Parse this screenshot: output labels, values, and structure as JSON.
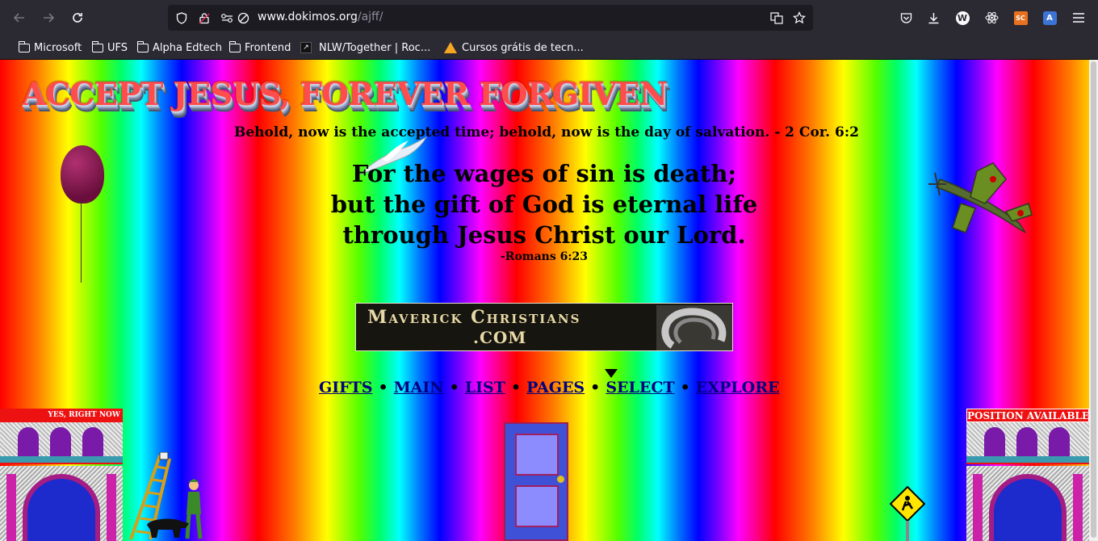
{
  "browser": {
    "url_host": "www.dokimos.org",
    "url_path": "/ajff/",
    "bookmarks": [
      {
        "label": "Microsoft",
        "type": "folder"
      },
      {
        "label": "UFS",
        "type": "folder"
      },
      {
        "label": "Alpha Edtech",
        "type": "folder"
      },
      {
        "label": "Frontend",
        "type": "folder"
      },
      {
        "label": "NLW/Together | Roc...",
        "type": "site"
      },
      {
        "label": "Cursos grátis de tecn...",
        "type": "site"
      }
    ],
    "extensions": {
      "w": "W",
      "sc": "SC",
      "translate": "A"
    }
  },
  "page": {
    "banner": "ACCEPT JESUS, FOREVER FORGIVEN",
    "subtitle": "Behold, now is the accepted time; behold, now is the day of salvation. - 2 Cor. 6:2",
    "verse_lines": [
      "For the wages of sin is death;",
      "but the gift of God is eternal life",
      "through Jesus Christ our Lord."
    ],
    "verse_ref": "-Romans 6:23",
    "maverick": {
      "line1": "Maverick Christians",
      "line2": ".COM"
    },
    "nav": [
      "GIFTS",
      "MAIN",
      "LIST",
      "PAGES",
      "SELECT",
      "EXPLORE"
    ],
    "nav_separator": "•",
    "left_building_sign": "YES, RIGHT NOW",
    "right_building_sign": "POSITION AVAILABLE"
  }
}
